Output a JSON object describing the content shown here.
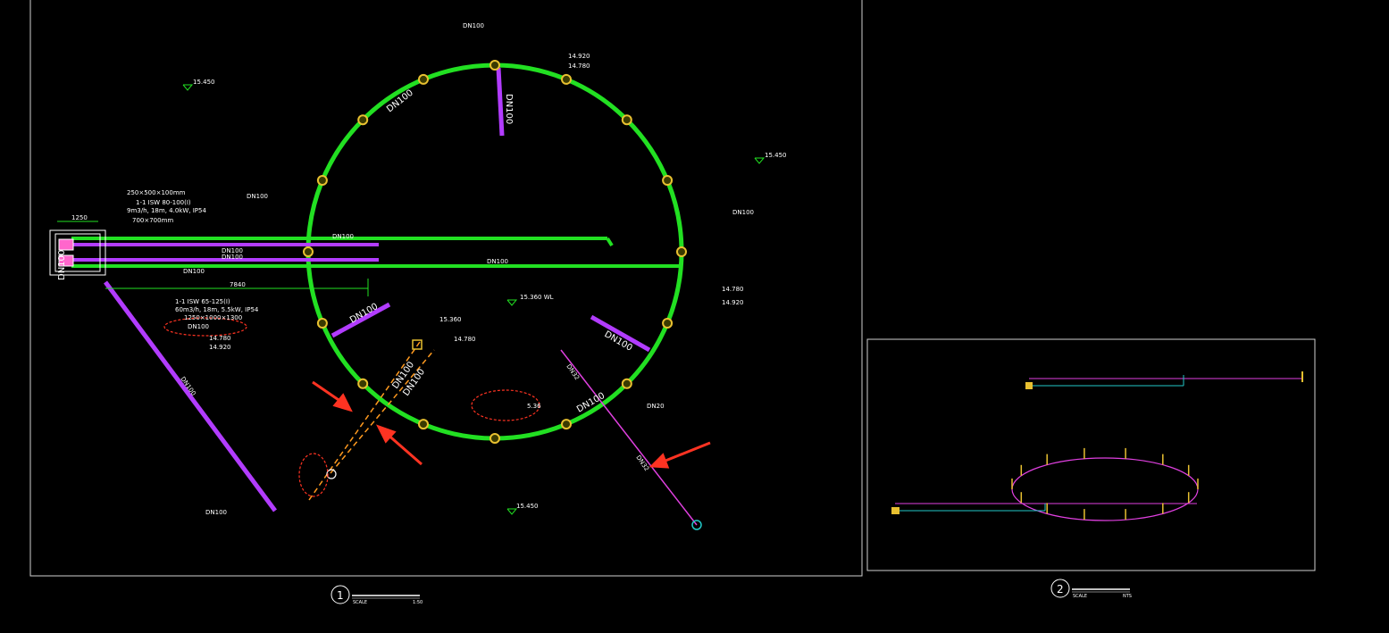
{
  "plan": {
    "title_dn100": "DN100",
    "top_elev_1": "14.920",
    "top_elev_2": "14.780",
    "elev_left": "15.450",
    "elev_right": "15.450",
    "elev_bottom": "15.450",
    "pipe_label_circle": "DN100",
    "pipe_label_top_spoke": "DN100",
    "pipe_label_right_dn100": "DN100",
    "right_elev_1": "14.780",
    "right_elev_2": "14.920",
    "pump1_spec_a": "250×500×100mm",
    "pump1_spec_b": "1-1 ISW 80-100(I)",
    "pump1_spec_c": "9m3/h, 18m, 4.0kW, IP54",
    "pump1_spec_d": "700×700mm",
    "dn100_mid_note": "DN100",
    "dim_1250": "1250",
    "pipe_dn100_a": "DN100",
    "pipe_dn100_b": "DN100",
    "pipe_dn100_c": "DN100",
    "pipe_dn100_d": "DN100",
    "pipe_dn100_main": "DN100",
    "dim_7840": "7840",
    "pump2_spec_a": "1-1 ISW 65-125(I)",
    "pump2_spec_b": "60m3/h, 18m, 5.5kW, IP54",
    "pump2_spec_c": "1250×1000×1300",
    "pump2_spec_d": "DN100",
    "pump2_elev_1": "14.780",
    "pump2_elev_2": "14.920",
    "wl": "15.360 WL",
    "center_elev_1": "15.360",
    "center_elev_2": "14.780",
    "spoke_left_dn100": "DN100",
    "spoke_right_dn100": "DN100",
    "diag_dn100": "DN100",
    "diag_dn100_b": "DN100",
    "cloud_value": "5.36",
    "dn32_a": "DN32",
    "dn32_b": "DN32",
    "dn20": "DN20",
    "dn100_lower": "DN100",
    "dn100_bottom_left": "DN100",
    "bottom_note_1": "DN100",
    "vertical_dn100": "DN100",
    "caption_num": "1",
    "caption_scale": "SCALE",
    "caption_ratio": "1:50"
  },
  "detail": {
    "caption_num": "2",
    "caption_scale": "SCALE",
    "caption_ratio": "NTS"
  },
  "colors": {
    "ring": "#22e022",
    "purple": "#b23cff",
    "magenta": "#e040e0",
    "yellow": "#e8c030",
    "orange": "#ff9a1f",
    "red": "#ff3322",
    "cyan": "#22c8c8",
    "white": "#ffffff"
  }
}
